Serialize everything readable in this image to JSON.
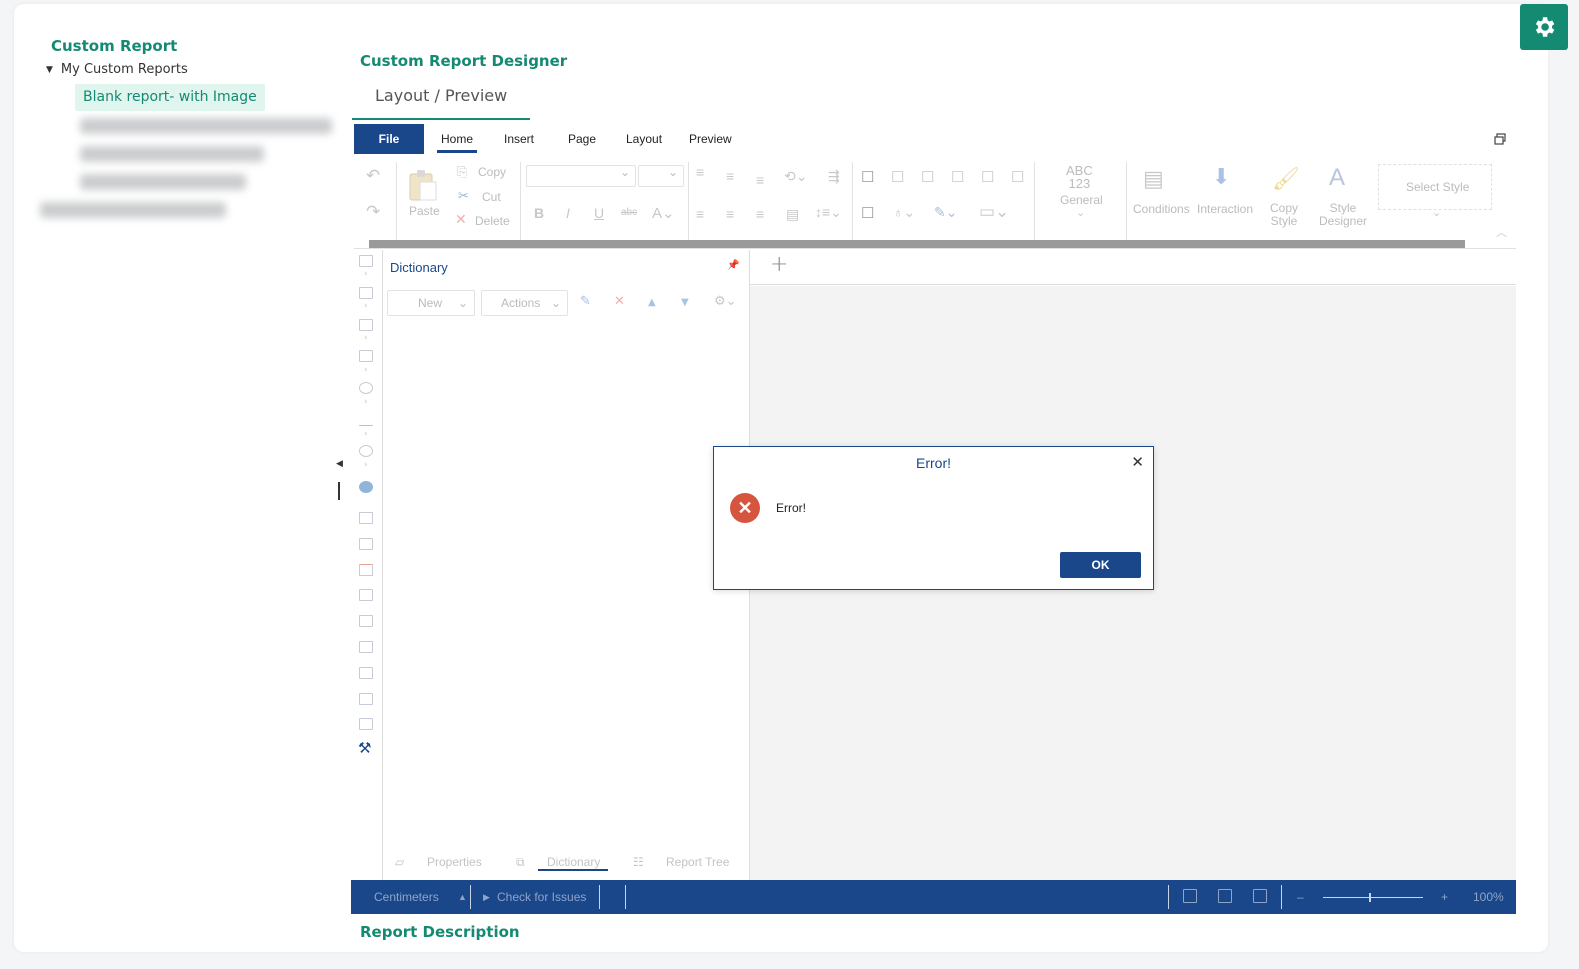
{
  "tree": {
    "title": "Custom Report",
    "root_label": "My Custom Reports",
    "selected_item": "Blank report- with Image"
  },
  "designer": {
    "title": "Custom Report Designer",
    "view_tab": "Layout / Preview"
  },
  "menu": {
    "file": "File",
    "tabs": [
      "Home",
      "Insert",
      "Page",
      "Layout",
      "Preview"
    ],
    "active_tab": "Home"
  },
  "ribbon": {
    "clipboard": {
      "paste": "Paste",
      "copy": "Copy",
      "cut": "Cut",
      "delete": "Delete"
    },
    "text_format": {
      "sample": "ABC\n123",
      "label": "General"
    },
    "style": {
      "conditions": "Conditions",
      "interaction": "Interaction",
      "copy_style": "Copy Style",
      "style_designer": "Style Designer",
      "select_style": "Select Style"
    }
  },
  "dictionary": {
    "title": "Dictionary",
    "new_label": "New",
    "actions_label": "Actions",
    "panel_tabs": [
      "Properties",
      "Dictionary",
      "Report Tree"
    ],
    "active_panel_tab": "Dictionary"
  },
  "statusbar": {
    "units": "Centimeters",
    "check_issues": "Check for Issues",
    "zoom": "100%"
  },
  "report_description_title": "Report Description",
  "dialog": {
    "title": "Error!",
    "message": "Error!",
    "ok_label": "OK"
  },
  "colors": {
    "brand_green": "#148a72",
    "brand_blue": "#19478a",
    "error_red": "#d6553f"
  }
}
